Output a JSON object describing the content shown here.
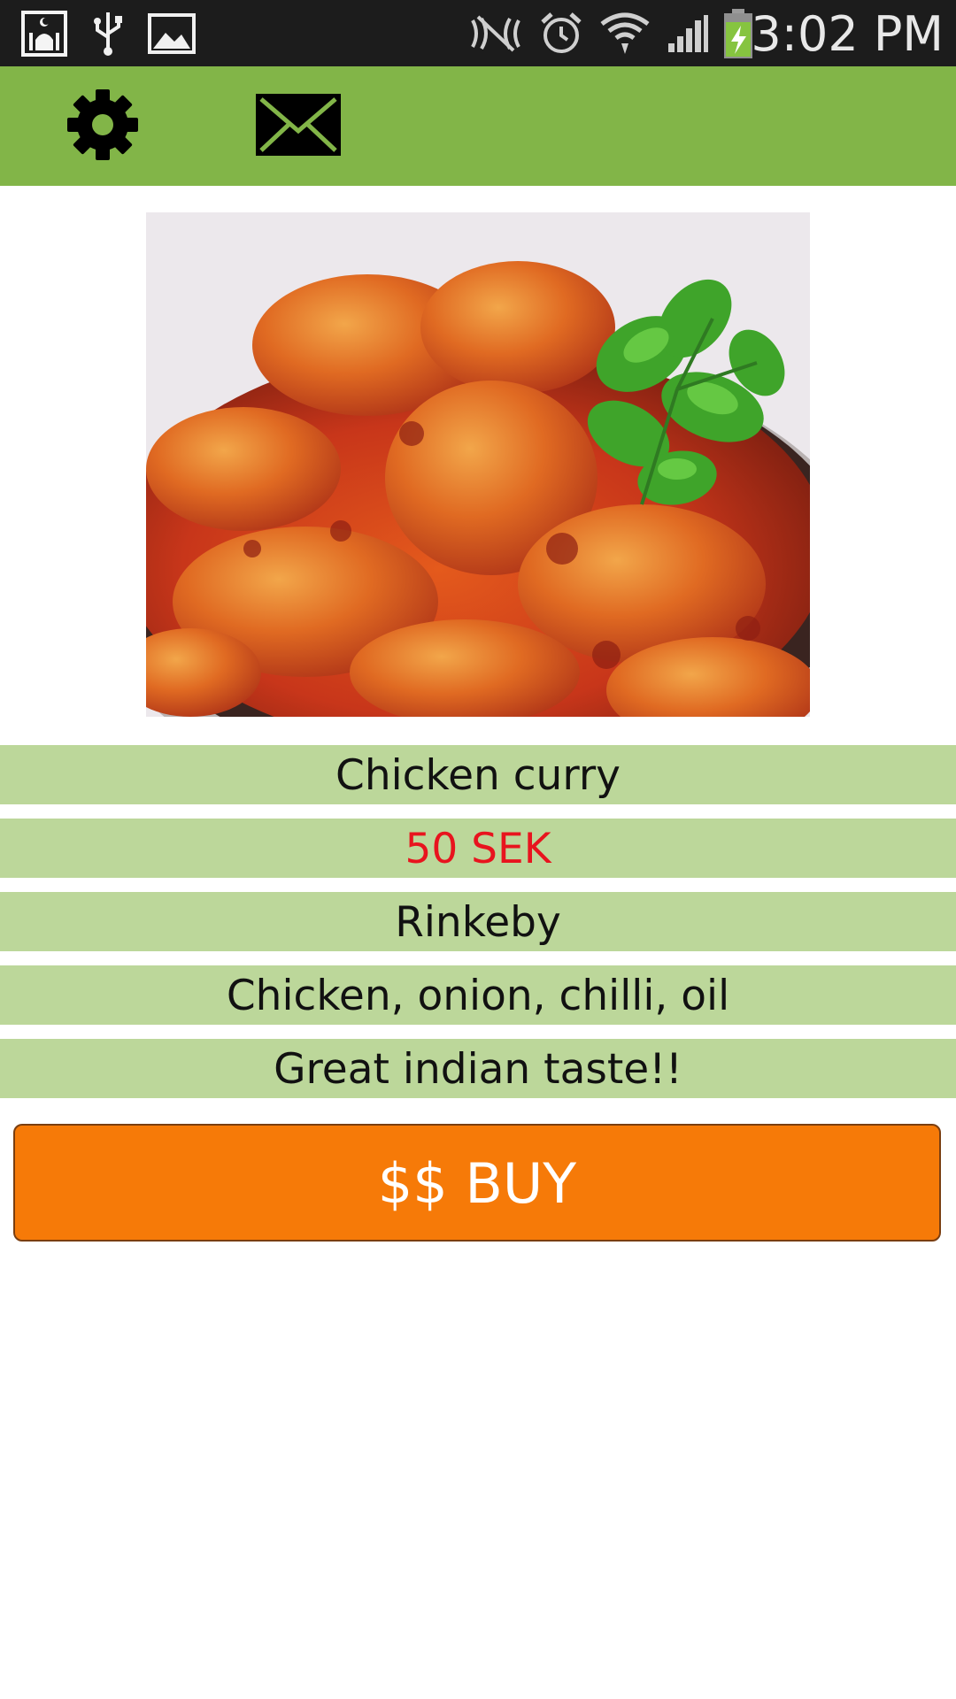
{
  "status_bar": {
    "time": "3:02 PM",
    "icons": [
      "mosque-app-icon",
      "usb-icon",
      "gallery-icon",
      "nfc-off-icon",
      "alarm-icon",
      "wifi-icon",
      "signal-icon",
      "battery-charging-icon"
    ]
  },
  "toolbar": {
    "icons": [
      "gear-icon",
      "mail-icon"
    ],
    "color": "#82b548"
  },
  "item": {
    "name": "Chicken curry",
    "price": "50 SEK",
    "location": "Rinkeby",
    "ingredients": "Chicken, onion, chilli, oil",
    "description": "Great indian taste!!"
  },
  "buy_button": {
    "label": "$$ BUY",
    "color": "#f67a08"
  },
  "colors": {
    "row_background": "#bcd79a",
    "price_text": "#e8141e"
  }
}
